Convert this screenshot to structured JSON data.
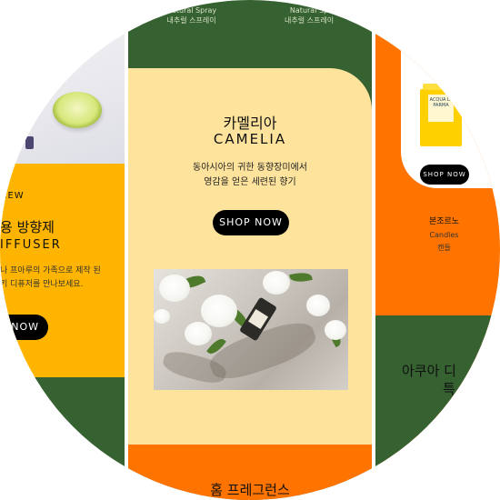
{
  "colors": {
    "green": "#366131",
    "orange": "#ff7400",
    "yellow": "#ffb400",
    "cream": "#fee39c",
    "button": "#000000"
  },
  "left_card": {
    "badge": "NEW",
    "title_kr": "용 방향제",
    "title_en": "IFFUSER",
    "desc_line1": "나 프아루의 가족으로 제작 된",
    "desc_line2": "키 디퓨저를 만나보세요.",
    "button_label": "NOW"
  },
  "top_strip": {
    "items": [
      {
        "line1": "Natural Spray",
        "line2": "내추럴 스프레이"
      },
      {
        "line1": "Natural Sp",
        "line2": "내추럴 스프레이"
      }
    ]
  },
  "center_card": {
    "title_kr": "카멜리아",
    "title_en": "CAMELIA",
    "desc_line1": "동아시아의 귀한 동향장미에서",
    "desc_line2": "영감을 얻은 세련된 향기",
    "button_label": "SHOP NOW",
    "bottom_heading": "홈 프레그런스"
  },
  "right_card": {
    "product_label": "ACQUA DI PARMA",
    "button_label": "SHOP NOW",
    "brand": "본조르노",
    "category_en": "Candles",
    "category_kr": "캔들",
    "heading_line1": "아쿠아 디",
    "heading_line2": "특"
  }
}
